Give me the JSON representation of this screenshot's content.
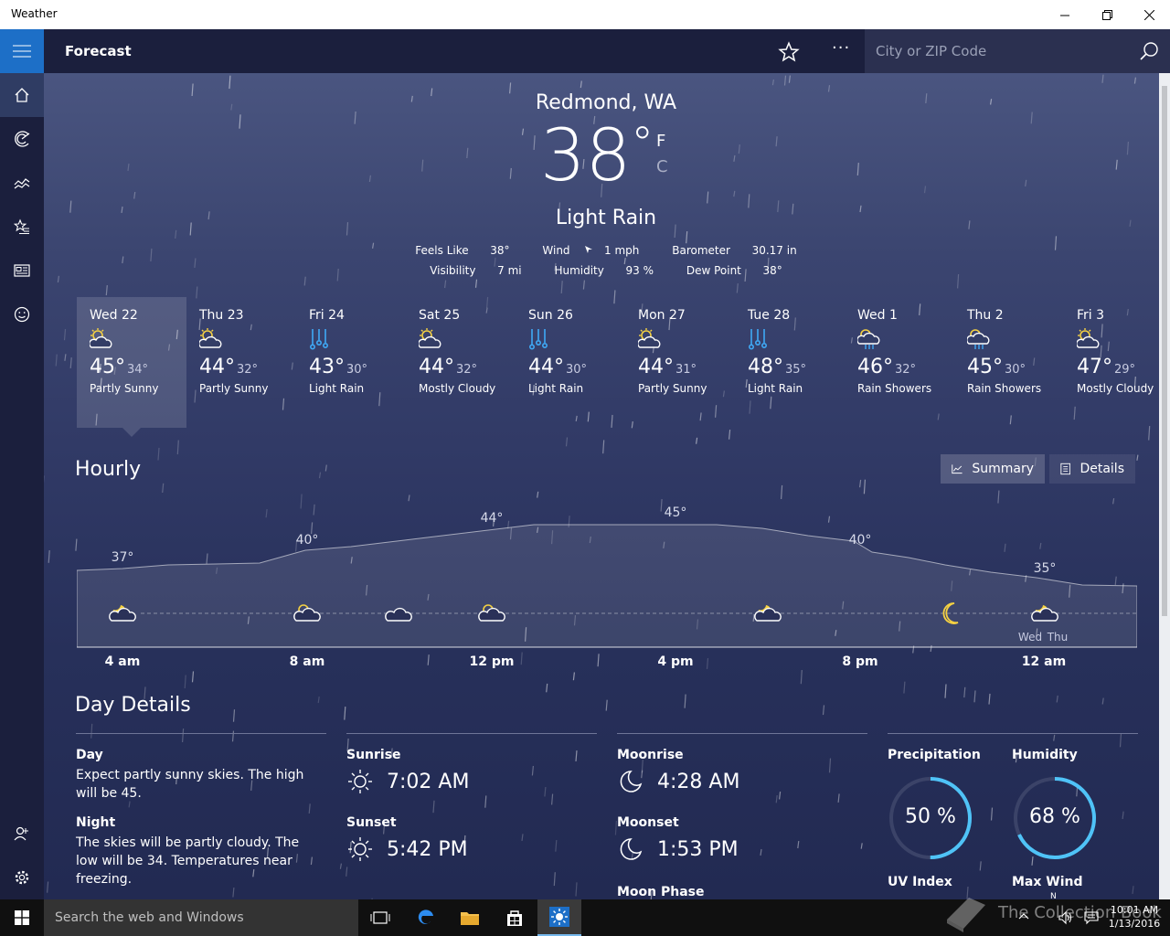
{
  "window": {
    "title": "Weather"
  },
  "appbar": {
    "title": "Forecast",
    "search_placeholder": "City or ZIP Code",
    "more_label": "···"
  },
  "current": {
    "location": "Redmond, WA",
    "temperature": "38",
    "degree": "°",
    "unit_f": "F",
    "unit_c": "C",
    "condition": "Light Rain",
    "stats_row1": [
      {
        "label": "Feels Like",
        "value": "38°"
      },
      {
        "label": "Wind",
        "value": "1 mph"
      },
      {
        "label": "Barometer",
        "value": "30.17 in"
      }
    ],
    "stats_row2": [
      {
        "label": "Visibility",
        "value": "7 mi"
      },
      {
        "label": "Humidity",
        "value": "93 %"
      },
      {
        "label": "Dew Point",
        "value": "38°"
      }
    ]
  },
  "daily": [
    {
      "day": "Wed 22",
      "high": "45°",
      "low": "34°",
      "condition": "Partly Sunny",
      "icon": "partly-sunny"
    },
    {
      "day": "Thu 23",
      "high": "44°",
      "low": "32°",
      "condition": "Partly Sunny",
      "icon": "partly-sunny"
    },
    {
      "day": "Fri 24",
      "high": "43°",
      "low": "30°",
      "condition": "Light Rain",
      "icon": "rain"
    },
    {
      "day": "Sat 25",
      "high": "44°",
      "low": "32°",
      "condition": "Mostly Cloudy",
      "icon": "partly-sunny"
    },
    {
      "day": "Sun 26",
      "high": "44°",
      "low": "30°",
      "condition": "Light Rain",
      "icon": "rain"
    },
    {
      "day": "Mon 27",
      "high": "44°",
      "low": "31°",
      "condition": "Partly Sunny",
      "icon": "partly-sunny"
    },
    {
      "day": "Tue 28",
      "high": "48°",
      "low": "35°",
      "condition": "Light Rain",
      "icon": "rain"
    },
    {
      "day": "Wed 1",
      "high": "46°",
      "low": "32°",
      "condition": "Rain Showers",
      "icon": "showers"
    },
    {
      "day": "Thu 2",
      "high": "45°",
      "low": "30°",
      "condition": "Rain Showers",
      "icon": "showers"
    },
    {
      "day": "Fri 3",
      "high": "47°",
      "low": "29°",
      "condition": "Mostly Cloudy",
      "icon": "partly-sunny"
    }
  ],
  "hourly": {
    "title": "Hourly",
    "summary_label": "Summary",
    "details_label": "Details",
    "temp_labels": [
      "37°",
      "40°",
      "44°",
      "45°",
      "40°",
      "35°"
    ],
    "time_labels": [
      "4 am",
      "8 am",
      "12 pm",
      "4 pm",
      "8 pm",
      "12 am"
    ],
    "day_change": [
      "Wed",
      "Thu"
    ]
  },
  "day_details": {
    "title": "Day Details",
    "day_label": "Day",
    "day_text": "Expect partly sunny skies. The high will be 45.",
    "night_label": "Night",
    "night_text": "The skies will be partly cloudy. The low will be 34. Temperatures near freezing.",
    "sunrise_label": "Sunrise",
    "sunrise": "7:02 AM",
    "sunset_label": "Sunset",
    "sunset": "5:42 PM",
    "moonrise_label": "Moonrise",
    "moonrise": "4:28 AM",
    "moonset_label": "Moonset",
    "moonset": "1:53 PM",
    "moonphase_label": "Moon Phase",
    "precip_label": "Precipitation",
    "precip_value": "50 %",
    "precip_fraction": 0.5,
    "humidity_label": "Humidity",
    "humidity_value": "68 %",
    "humidity_fraction": 0.68,
    "uv_label": "UV Index",
    "wind_label": "Max Wind",
    "wind_dir": "N"
  },
  "taskbar": {
    "search_placeholder": "Search the web and Windows",
    "time": "10:01 AM",
    "date": "1/13/2016",
    "watermark": "The Collection Book"
  },
  "colors": {
    "accent": "#1d6fc7",
    "ring": "#4fc3f7",
    "sun": "#f5d142",
    "rain": "#3fa9f5"
  }
}
